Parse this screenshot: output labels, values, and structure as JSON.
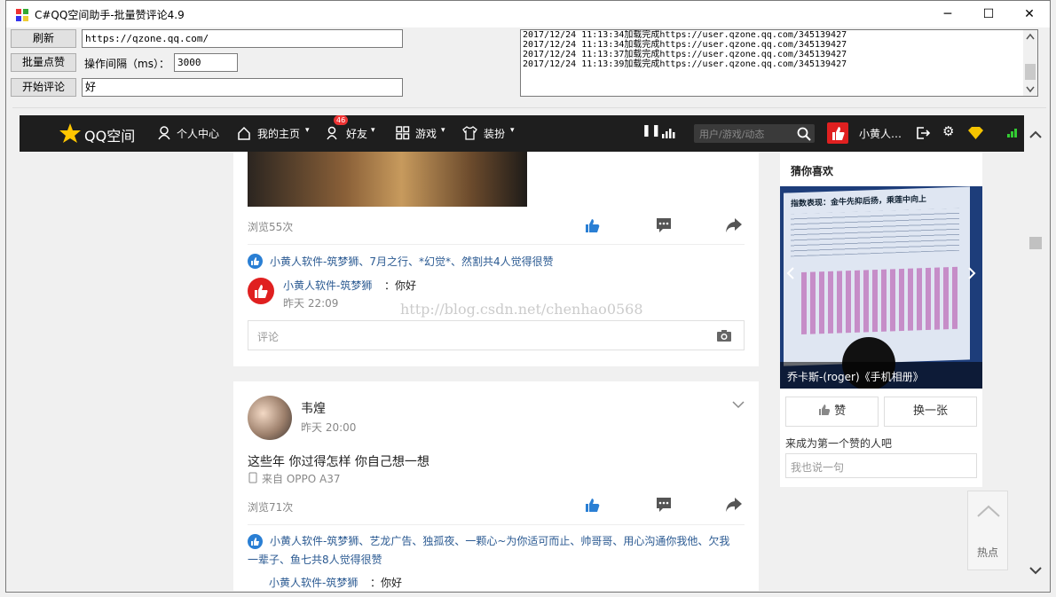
{
  "window": {
    "title": "C#QQ空间助手-批量赞评论4.9",
    "minimize": "─",
    "maximize": "☐",
    "close": "✕"
  },
  "controls": {
    "refresh_label": "刷新",
    "url_value": "https://qzone.qq.com/",
    "batch_like_label": "批量点赞",
    "interval_label": "操作间隔（ms）：",
    "interval_value": "3000",
    "start_comment_label": "开始评论",
    "comment_value": "好"
  },
  "log": {
    "lines": [
      "2017/12/24 11:13:34加载完成https://user.qzone.qq.com/345139427",
      "2017/12/24 11:13:34加载完成https://user.qzone.qq.com/345139427",
      "2017/12/24 11:13:37加载完成https://user.qzone.qq.com/345139427",
      "2017/12/24 11:13:39加载完成https://user.qzone.qq.com/345139427"
    ]
  },
  "nav": {
    "logo": "QQ空间",
    "personal_center": "个人中心",
    "my_home": "我的主页",
    "friends": "好友",
    "friends_badge": "46",
    "games": "游戏",
    "dress": "装扮",
    "search_placeholder": "用户/游戏/动态",
    "user_name": "小黄人…"
  },
  "post1": {
    "views": "浏览55次",
    "likes_text": "小黄人软件-筑梦狮、7月之行、*幻觉*、然割共4人觉得很赞",
    "comment_author": "小黄人软件-筑梦狮",
    "comment_text": "：你好",
    "comment_time": "昨天 22:09",
    "comment_placeholder": "评论"
  },
  "post2": {
    "author": "韦煌",
    "time": "昨天 20:00",
    "content": "这些年 你过得怎样 你自己想一想",
    "device": "来自 OPPO A37",
    "views": "浏览71次",
    "likes_text": "小黄人软件-筑梦狮、艺龙广告、独孤夜、一颗心~为你适可而止、帅哥哥、用心沟通你我他、欠我一辈子、鱼七共8人觉得很赞",
    "comment_author": "小黄人软件-筑梦狮",
    "comment_text": "：你好"
  },
  "sidebar": {
    "title": "猜你喜欢",
    "image_caption": "乔卡斯-(roger)《手机相册》",
    "slide_title": "指数表现：金牛先抑后扬，乘莲中向上",
    "like_button": "赞",
    "swap_button": "换一张",
    "first_like_prompt": "来成为第一个赞的人吧",
    "comment_placeholder": "我也说一句"
  },
  "hot_label": "热点",
  "watermark": "http://blog.csdn.net/chenhao0568",
  "colors": {
    "nav_bg": "#1e1e1e",
    "link_blue": "#2b5a92",
    "like_blue": "#2a7fd4",
    "qq_yellow": "#ffc600",
    "avatar_red": "#e02020"
  }
}
